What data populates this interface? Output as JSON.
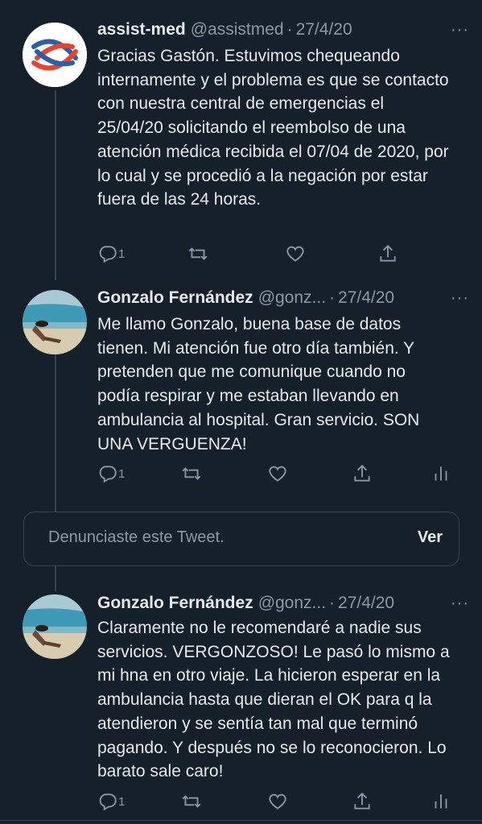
{
  "tweets": [
    {
      "name": "assist-med",
      "handle": "@assistmed",
      "dot": "·",
      "date": "27/4/20",
      "more": "···",
      "text": "Gracias Gastón. Estuvimos chequeando internamente y el problema es que se contacto con nuestra central de emergencias el 25/04/20 solicitando el reembolso de una atención médica recibida el 07/04 de 2020, por lo cual y se procedió a la negación por estar fuera de las 24 horas.",
      "reply_count": "1",
      "avatar_icon": "assist-med-logo"
    },
    {
      "name": "Gonzalo Fernández",
      "handle": "@gonz...",
      "dot": "·",
      "date": "27/4/20",
      "more": "···",
      "text": "Me llamo Gonzalo, buena base de datos tienen. Mi atención fue otro día también. Y pretenden que me comunique cuando no podía respirar y me estaban llevando en ambulancia al hospital. Gran servicio. SON UNA VERGUENZA!",
      "reply_count": "1",
      "avatar_icon": "beach-photo"
    },
    {
      "name": "Gonzalo Fernández",
      "handle": "@gonz...",
      "dot": "·",
      "date": "27/4/20",
      "more": "···",
      "text": "Claramente no le recomendaré a nadie sus servicios. VERGONZOSO! Le pasó lo mismo a mi hna en otro viaje. La hicieron esperar en la ambulancia hasta que dieran el OK para q la atendieron y se sentía tan mal que terminó pagando. Y después no se lo reconocieron. Lo barato sale caro!",
      "reply_count": "1",
      "avatar_icon": "beach-photo"
    }
  ],
  "reported": {
    "text": "Denunciaste este Tweet.",
    "action": "Ver"
  },
  "icons": {
    "reply": "reply-icon",
    "retweet": "retweet-icon",
    "like": "heart-icon",
    "share": "share-icon",
    "analytics": "analytics-icon"
  },
  "colors": {
    "background": "#15202b",
    "text": "#e7e9ea",
    "muted": "#8b98a5",
    "border": "#38444d",
    "logo_red": "#e8432e",
    "logo_blue": "#2d5ea8"
  }
}
